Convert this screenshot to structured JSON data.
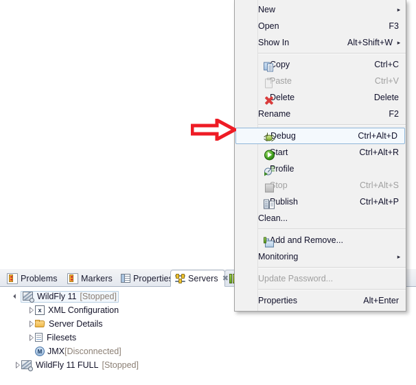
{
  "context_menu": {
    "items": [
      {
        "label": "New",
        "accel": "",
        "icon": "",
        "submenu": true,
        "disabled": false,
        "selected": false,
        "separator_after": false
      },
      {
        "label": "Open",
        "accel": "F3",
        "icon": "",
        "submenu": false,
        "disabled": false,
        "selected": false,
        "separator_after": false
      },
      {
        "label": "Show In",
        "accel": "Alt+Shift+W",
        "icon": "",
        "submenu": true,
        "disabled": false,
        "selected": false,
        "separator_after": true
      },
      {
        "label": "Copy",
        "accel": "Ctrl+C",
        "icon": "copy-icon",
        "submenu": false,
        "disabled": false,
        "selected": false,
        "separator_after": false
      },
      {
        "label": "Paste",
        "accel": "Ctrl+V",
        "icon": "paste-icon",
        "submenu": false,
        "disabled": true,
        "selected": false,
        "separator_after": false
      },
      {
        "label": "Delete",
        "accel": "Delete",
        "icon": "delete-icon",
        "submenu": false,
        "disabled": false,
        "selected": false,
        "separator_after": false
      },
      {
        "label": "Rename",
        "accel": "F2",
        "icon": "",
        "submenu": false,
        "disabled": false,
        "selected": false,
        "separator_after": true
      },
      {
        "label": "Debug",
        "accel": "Ctrl+Alt+D",
        "icon": "debug-icon",
        "submenu": false,
        "disabled": false,
        "selected": true,
        "separator_after": false
      },
      {
        "label": "Start",
        "accel": "Ctrl+Alt+R",
        "icon": "start-icon",
        "submenu": false,
        "disabled": false,
        "selected": false,
        "separator_after": false
      },
      {
        "label": "Profile",
        "accel": "",
        "icon": "profile-icon",
        "submenu": false,
        "disabled": false,
        "selected": false,
        "separator_after": false
      },
      {
        "label": "Stop",
        "accel": "Ctrl+Alt+S",
        "icon": "stop-icon",
        "submenu": false,
        "disabled": true,
        "selected": false,
        "separator_after": false
      },
      {
        "label": "Publish",
        "accel": "Ctrl+Alt+P",
        "icon": "publish-icon",
        "submenu": false,
        "disabled": false,
        "selected": false,
        "separator_after": false
      },
      {
        "label": "Clean...",
        "accel": "",
        "icon": "",
        "submenu": false,
        "disabled": false,
        "selected": false,
        "separator_after": true
      },
      {
        "label": "Add and Remove...",
        "accel": "",
        "icon": "add-remove-icon",
        "submenu": false,
        "disabled": false,
        "selected": false,
        "separator_after": false
      },
      {
        "label": "Monitoring",
        "accel": "",
        "icon": "",
        "submenu": true,
        "disabled": false,
        "selected": false,
        "separator_after": true
      },
      {
        "label": "Update Password...",
        "accel": "",
        "icon": "",
        "submenu": false,
        "disabled": true,
        "selected": false,
        "separator_after": true
      },
      {
        "label": "Properties",
        "accel": "Alt+Enter",
        "icon": "",
        "submenu": false,
        "disabled": false,
        "selected": false,
        "separator_after": false
      }
    ],
    "submenu_arrow_glyph": "▸"
  },
  "view_panel": {
    "tabs": [
      {
        "label": "Problems",
        "icon": "problems-icon",
        "active": false,
        "closable": false
      },
      {
        "label": "Markers",
        "icon": "markers-icon",
        "active": false,
        "closable": false
      },
      {
        "label": "Properties",
        "icon": "properties-icon",
        "active": false,
        "closable": false
      },
      {
        "label": "Servers",
        "icon": "servers-icon",
        "active": true,
        "closable": true
      },
      {
        "label": "",
        "icon": "snippets-icon",
        "active": false,
        "closable": false
      }
    ],
    "close_glyph": "✖"
  },
  "servers_tree": {
    "nodes": [
      {
        "name": "WildFly 11",
        "status": "[Stopped]",
        "icon": "server-icon",
        "indent": 0,
        "twisty": "expanded",
        "selected": true
      },
      {
        "name": "XML Configuration",
        "status": "",
        "icon": "xml-icon",
        "icon_text": "x",
        "indent": 1,
        "twisty": "collapsed",
        "selected": false
      },
      {
        "name": "Server Details",
        "status": "",
        "icon": "folder-icon",
        "indent": 1,
        "twisty": "collapsed",
        "selected": false
      },
      {
        "name": "Filesets",
        "status": "",
        "icon": "file-icon",
        "indent": 1,
        "twisty": "collapsed",
        "selected": false
      },
      {
        "name": "JMX",
        "status": "[Disconnected]",
        "icon": "jmx-icon",
        "icon_text": "M",
        "indent": 1,
        "twisty": "none",
        "selected": false
      },
      {
        "name": "WildFly 11 FULL",
        "status": "[Stopped]",
        "icon": "server-icon",
        "indent": 0,
        "twisty": "collapsed",
        "selected": false
      }
    ]
  },
  "annotation": {
    "arrow": {
      "name": "red-pointer-arrow",
      "direction": "right",
      "color": "#EE1C25",
      "points_to": "Debug"
    }
  },
  "colors": {
    "menu_bg": "#F1F1F1",
    "menu_border": "#A0A0A0",
    "selection_bg": "#F4F9FD",
    "selection_border": "#8FB6D8",
    "disabled_text": "#A0A0A0",
    "status_text": "#8B7F74",
    "accent_red": "#EE1C25",
    "tab_active_bg": "#FFFFFF"
  }
}
